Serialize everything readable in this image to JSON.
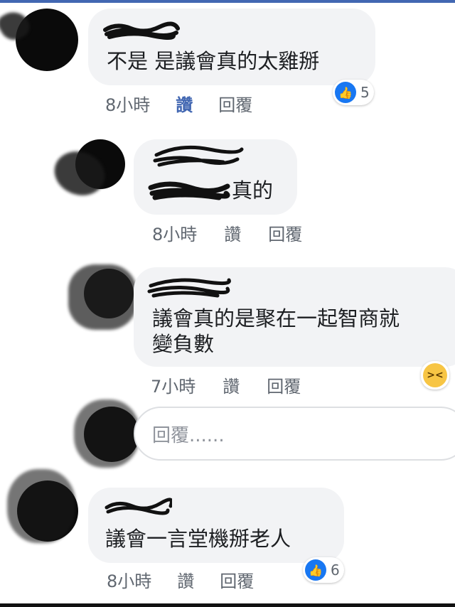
{
  "comments": [
    {
      "text": "不是 是議會真的太雞掰",
      "time": "8小時",
      "like_label": "讚",
      "reply_label": "回覆",
      "reaction_count": "5",
      "reaction_icon": "like-icon"
    },
    {
      "text": "真的",
      "time": "8小時",
      "like_label": "讚",
      "reply_label": "回覆"
    },
    {
      "text_line1": "議會真的是聚在一起智商就",
      "text_line2": "變負數",
      "time": "7小時",
      "like_label": "讚",
      "reply_label": "回覆",
      "reaction_icon": "haha-icon"
    },
    {
      "text": "議會一言堂機掰老人",
      "time": "8小時",
      "like_label": "讚",
      "reply_label": "回覆",
      "reaction_count": "6",
      "reaction_icon": "like-icon"
    }
  ],
  "reply_box": {
    "placeholder": "回覆......"
  },
  "colors": {
    "accent": "#4267b2",
    "bubble": "#f2f3f5",
    "meta": "#606770"
  }
}
